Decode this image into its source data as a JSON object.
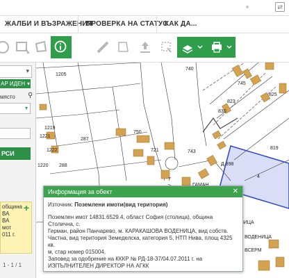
{
  "topbar": {
    "icon": "translate-icon"
  },
  "nav": {
    "items": [
      {
        "label": "ЖАЛБИ И ВЪЗРАЖЕНИЯ"
      },
      {
        "label": "ПРОВЕРКА НА СТАТУС"
      },
      {
        "label": "КАК ДА..."
      }
    ]
  },
  "toolbar": {
    "tools": [
      "rotate-icon",
      "select-rectangle-icon",
      "select-polygon-icon",
      "info-icon",
      "measure-distance-icon",
      "measure-area-icon",
      "upload-icon",
      "clear-selection-icon",
      "layers-icon",
      "print-icon"
    ]
  },
  "left_panel": {
    "green_label": "АР ИДЕН",
    "place_label": "място",
    "search_button": "РСИ",
    "result_lines": [
      "община",
      "ВА",
      "ВА",
      "мот",
      "011 г."
    ],
    "pager": "1 - 1 / 1"
  },
  "map": {
    "labels": [
      "1205",
      "740",
      "745",
      "830",
      "823",
      "825",
      "1219",
      "1222",
      "1221",
      "287",
      "750",
      "721",
      "819",
      "288",
      "1220",
      "4",
      "Д.898",
      "743",
      "7",
      "ГАМАН",
      "ЕЗИЦА",
      "ВОДЕНИЦА",
      "ВСЕРМ"
    ]
  },
  "popup": {
    "title": "Информация за обект",
    "source_label": "Източник:",
    "source_value": "Поземлени имоти(вид територия)",
    "body_lines": [
      "Поземлен имот 14831.6529.4, област София (столица), община Столична, с.",
      "Герман, район Панчарево, м. КАРАКАШОВА ВОДЕНИЦА, вид собств.",
      "Частна, вид територия Земеделска, категория 5, НТП Нива, площ 4325 кв.",
      "м, стар номер 015004,",
      "Заповед за одобрение на КККР № РД-18-37/04.07.2011 г. на",
      "ИЗПЪЛНИТЕЛЕН ДИРЕКТОР НА АГКК"
    ]
  },
  "colors": {
    "accent": "#2e9e4b",
    "building": "#d5a24f",
    "parcel_highlight": "#2a45c8"
  }
}
